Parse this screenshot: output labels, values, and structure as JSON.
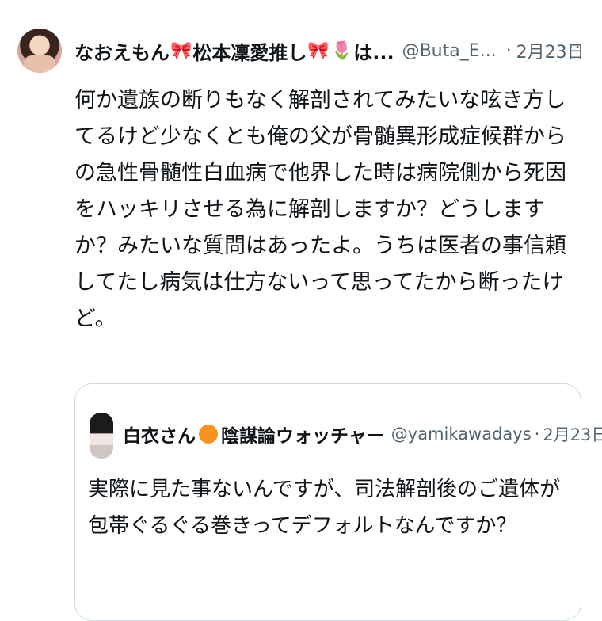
{
  "tweet": {
    "avatar_icon": "user-avatar",
    "name_part1": "なおえもん",
    "ribbon_emoji_1": "🎀",
    "name_part2": "松本凜愛推し",
    "ribbon_emoji_2": "🎀",
    "tulip_emoji": "🌷",
    "name_part3": "は...",
    "handle": "@Buta_E...",
    "separator": "·",
    "date": "2月23日",
    "more_label": "···",
    "text": "何か遺族の断りもなく解剖されてみたいな呟き方してるけど少なくとも俺の父が骨髄異形成症候群からの急性骨髄性白血病で他界した時は病院側から死因をハッキリさせる為に解剖しますか？どうしますか？みたいな質問はあったよ。うちは医者の事信頼してたし病気は仕方ないって思ってたから断ったけど。"
  },
  "quoted_tweet": {
    "avatar_icon": "user-avatar",
    "name_part1": "白衣さん",
    "orange_circle": "🟠",
    "name_part2": "陰謀論ウォッチャー",
    "handle": "@yamikawadays",
    "separator": "·",
    "date": "2月23日",
    "text": "実際に見た事ないんですが、司法解剖後のご遺体が包帯ぐるぐる巻きってデフォルトなんですか？"
  },
  "colors": {
    "text_primary": "#0f1419",
    "text_secondary": "#536471",
    "border": "#cfd9de",
    "accent_orange": "#f7931e",
    "ribbon_red": "#e0245e"
  }
}
